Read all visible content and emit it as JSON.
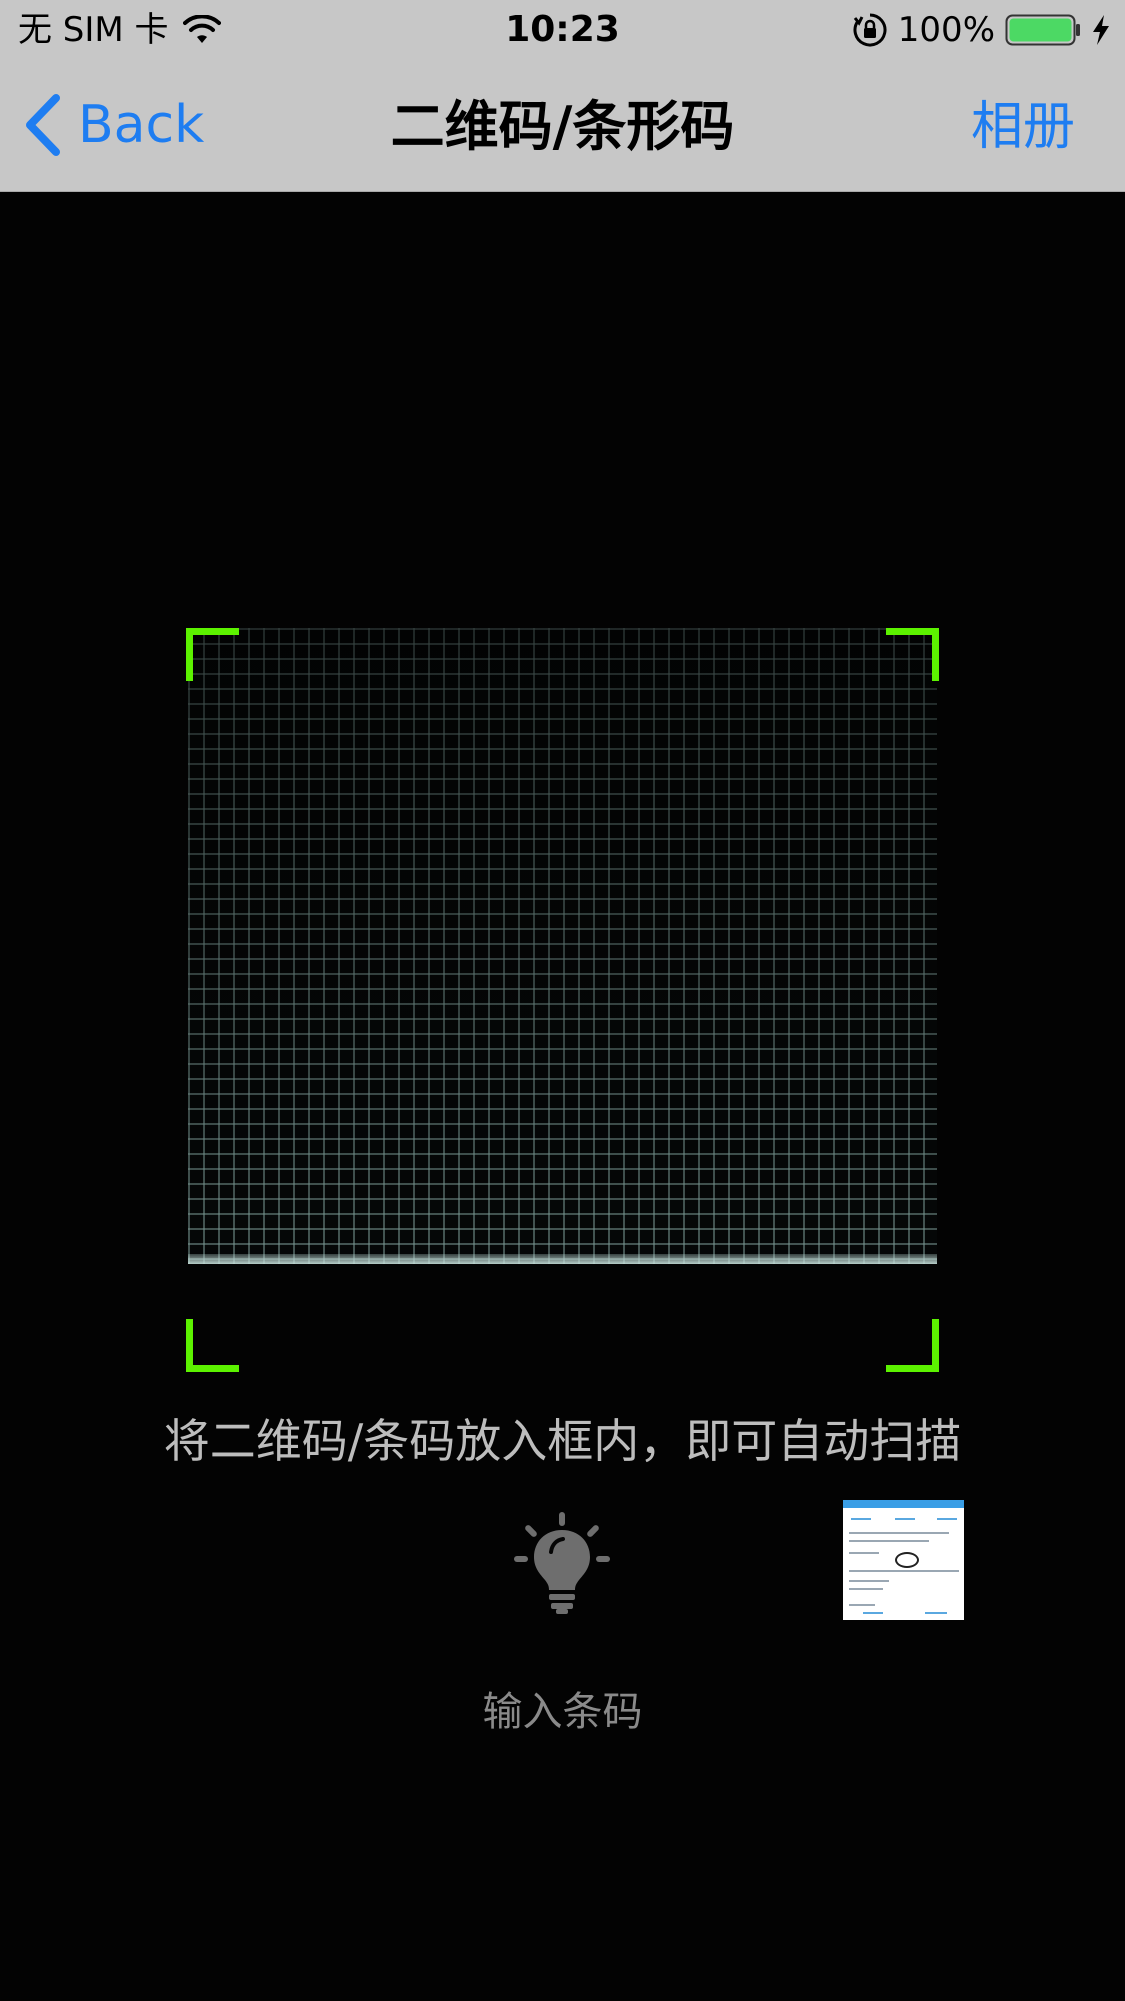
{
  "status_bar": {
    "carrier": "无 SIM 卡",
    "time": "10:23",
    "battery_percent": "100%",
    "battery_level": 1.0,
    "battery_color": "#4cd964",
    "icons": [
      "wifi-icon",
      "orientation-lock-icon",
      "battery-icon",
      "charging-bolt-icon"
    ]
  },
  "nav": {
    "back_label": "Back",
    "title": "二维码/条形码",
    "album_label": "相册",
    "tint_color": "#1e7df1"
  },
  "scanner": {
    "corner_color": "#5cf200",
    "hint": "将二维码/条码放入框内，即可自动扫描"
  },
  "controls": {
    "flashlight_icon": "lightbulb-icon",
    "input_barcode_label": "输入条码"
  },
  "thumbnail": {
    "icon": "photo-thumbnail"
  }
}
